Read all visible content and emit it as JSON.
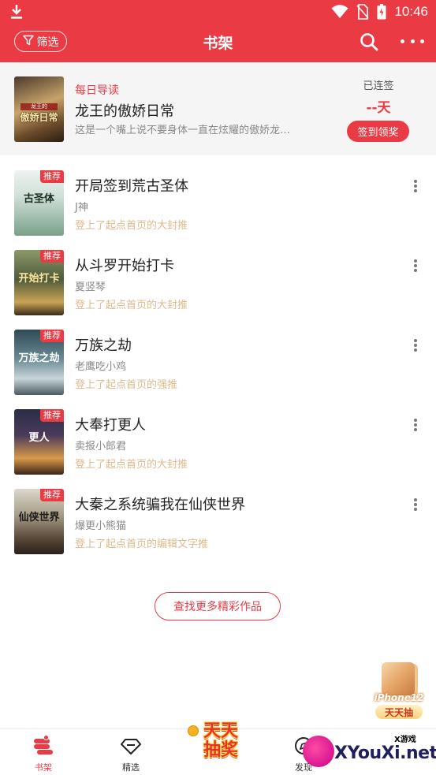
{
  "status_bar": {
    "time": "10:46",
    "icons": [
      "download-icon",
      "wifi-icon",
      "no-sim-icon",
      "battery-icon"
    ]
  },
  "header": {
    "filter_label": "筛选",
    "title": "书架",
    "search_icon": "search-icon",
    "more_icon": "more-horizontal-icon"
  },
  "daily": {
    "tag": "每日导读",
    "title": "龙王的傲娇日常",
    "description": "这是一个嘴上说不要身体一直在炫耀的傲娇龙…",
    "cover_text": "傲娇日常",
    "cover_small": "龙王的",
    "streak_label": "已连签",
    "streak_value": "--天",
    "checkin_label": "签到领奖"
  },
  "books": [
    {
      "title": "开局签到荒古圣体",
      "author": "J神",
      "note": "登上了起点首页的大封推",
      "badge": "推荐",
      "cover_text": "古圣体",
      "cover_bg": "linear-gradient(180deg,#eef3ef 0%,#cfe0d8 40%,#7aa088 100%)",
      "cover_fg": "#1e2e22"
    },
    {
      "title": "从斗罗开始打卡",
      "author": "夏竖琴",
      "note": "登上了起点首页的大封推",
      "badge": "推荐",
      "cover_text": "开始打卡",
      "cover_bg": "linear-gradient(180deg,#8c9a6a 0%,#4e5a3a 45%,#c9a457 80%,#3a2a18 100%)",
      "cover_fg": "#ffe6a0"
    },
    {
      "title": "万族之劫",
      "author": "老鹰吃小鸡",
      "note": "登上了起点首页的强推",
      "badge": "推荐",
      "cover_text": "万族之劫",
      "cover_bg": "linear-gradient(180deg,#2e4a56 0%,#6a8a94 45%,#c8d6da 75%,#4a5a5e 100%)",
      "cover_fg": "#ffffff"
    },
    {
      "title": "大奉打更人",
      "author": "卖报小郎君",
      "note": "登上了起点首页的大封推",
      "badge": "推荐",
      "cover_text": "更人",
      "cover_bg": "linear-gradient(180deg,#2a2e48 0%,#4a3a5a 40%,#d89a4a 75%,#3a2418 100%)",
      "cover_fg": "#ffffff"
    },
    {
      "title": "大秦之系统骗我在仙侠世界",
      "author": "爆更小熊猫",
      "note": "登上了起点首页的编辑文字推",
      "badge": "推荐",
      "cover_text": "仙侠世界",
      "cover_bg": "linear-gradient(180deg,#dcd8cc 0%,#a79c86 40%,#5a4a3a 75%,#2a201a 100%)",
      "cover_fg": "#1a1a1a"
    }
  ],
  "find_more_label": "查找更多精彩作品",
  "promo": {
    "model": "iPhone12",
    "label": "天天抽",
    "center_text": "天天抽奖"
  },
  "bottom_nav": [
    {
      "label": "书架",
      "icon": "bookshelf-icon",
      "active": true
    },
    {
      "label": "精选",
      "icon": "diamond-icon",
      "active": false
    },
    {
      "label": "发现",
      "icon": "compass-icon",
      "active": false
    }
  ],
  "watermark": {
    "small": "X游戏",
    "text": "XYouXi.net"
  },
  "colors": {
    "brand_red": "#ea3b45",
    "note_gold": "#e0b98c"
  }
}
